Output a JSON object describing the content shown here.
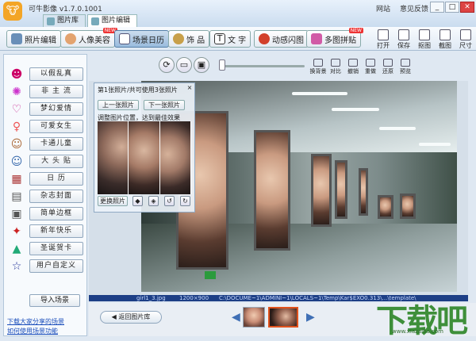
{
  "window": {
    "title": "可牛影像 v1.7.0.1001",
    "links": [
      "网站",
      "意见反馈"
    ],
    "minimize": "_",
    "maximize": "□",
    "close": "✕"
  },
  "main_tabs": [
    {
      "label": "图片库",
      "active": false
    },
    {
      "label": "图片编辑",
      "active": true
    }
  ],
  "toolbar": {
    "tools": [
      {
        "label": "照片编辑",
        "active": false,
        "hot": false
      },
      {
        "label": "人像美容",
        "active": false,
        "hot": true
      },
      {
        "label": "场景日历",
        "active": true,
        "hot": false
      },
      {
        "label": "饰 品",
        "active": false,
        "hot": false
      },
      {
        "label": "文 字",
        "active": false,
        "hot": false
      },
      {
        "label": "动感闪图",
        "active": false,
        "hot": false
      },
      {
        "label": "多图拼贴",
        "active": false,
        "hot": true
      }
    ],
    "hot_badge": "NEW",
    "right_tools": [
      "打开",
      "保存",
      "抠图",
      "截图",
      "尺寸"
    ]
  },
  "sidebar": {
    "categories": [
      {
        "label": "以假乱真",
        "icon": "mask-icon"
      },
      {
        "label": "非 主 流",
        "icon": "spark-icon"
      },
      {
        "label": "梦幻爱情",
        "icon": "heart-icon"
      },
      {
        "label": "可爱女生",
        "icon": "girl-icon"
      },
      {
        "label": "卡通儿童",
        "icon": "cartoon-icon"
      },
      {
        "label": "大 头 贴",
        "icon": "photobooth-icon"
      },
      {
        "label": "日  历",
        "icon": "calendar-icon"
      },
      {
        "label": "杂志封面",
        "icon": "magazine-icon"
      },
      {
        "label": "简单边框",
        "icon": "frame-icon"
      },
      {
        "label": "新年快乐",
        "icon": "newyear-icon"
      },
      {
        "label": "圣诞贺卡",
        "icon": "tree-icon"
      },
      {
        "label": "用户自定义",
        "icon": "star-icon"
      }
    ],
    "import_label": "导入场景",
    "links": [
      "下载大家分享的场景",
      "如何使用场景功能"
    ]
  },
  "controls": {
    "buttons": [
      "换背景",
      "对比",
      "撤销",
      "重做",
      "还原",
      "预览"
    ]
  },
  "scene_panel": {
    "title": "第1张照片/共可使用3张照片",
    "prev_label": "上一张照片",
    "next_label": "下一张照片",
    "hint": "调整图片位置，达到最佳效果",
    "replace_label": "更换照片"
  },
  "status": {
    "filename": "girl1_3.jpg",
    "size": "1200×900",
    "path": "C:\\DOCUME~1\\ADMINI~1\\LOCALS~1\\Temp\\Kar$EXO0.313\\...\\template\\"
  },
  "bottom": {
    "back_label": "返回图片库"
  },
  "brand": {
    "text": "下载吧",
    "sub": "www.xiazaiba.com"
  }
}
